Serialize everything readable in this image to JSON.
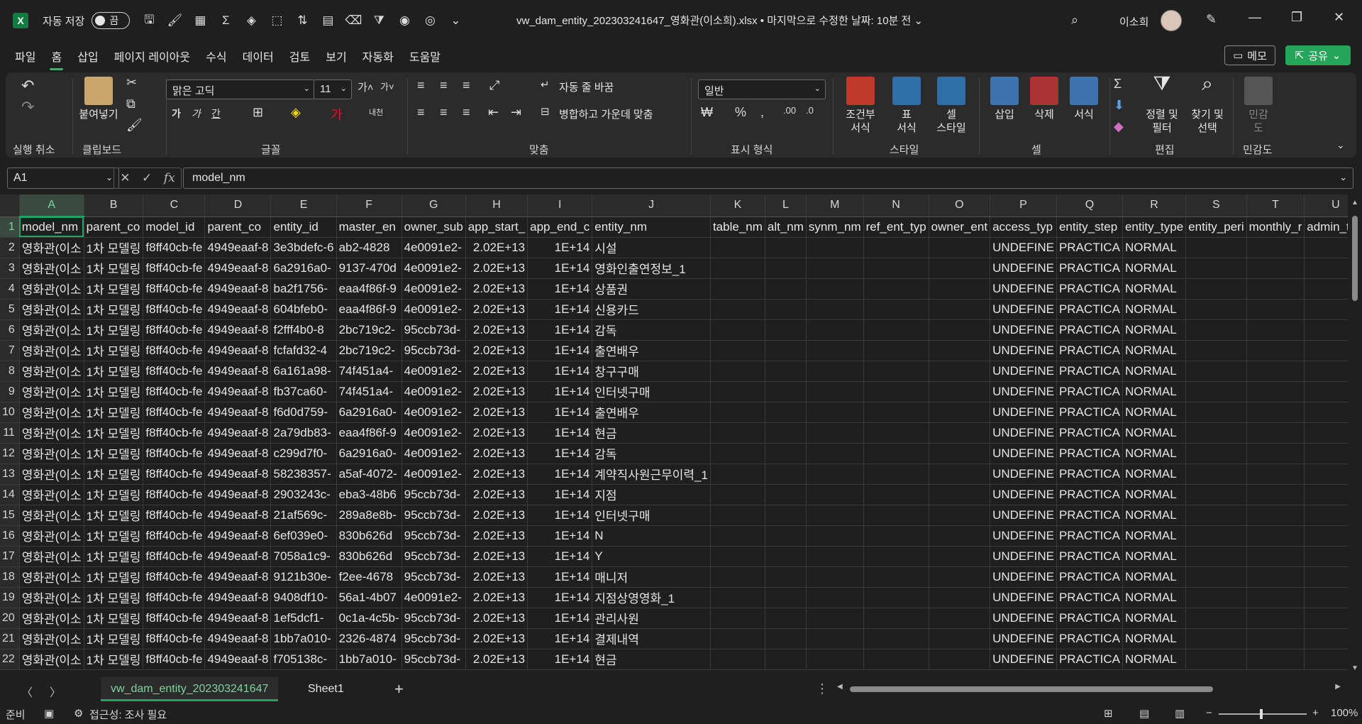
{
  "app": {
    "logo": "X",
    "autosave_label": "자동 저장",
    "autosave_state": "끔",
    "doc_title": "vw_dam_entity_202303241647_영화관(이소희).xlsx • 마지막으로 수정한 날짜: 10분 전 ⌄",
    "user_name": "이소희"
  },
  "tabs": [
    "파일",
    "홈",
    "삽입",
    "페이지 레이아웃",
    "수식",
    "데이터",
    "검토",
    "보기",
    "자동화",
    "도움말"
  ],
  "active_tab": "홈",
  "memo_label": "메모",
  "share_label": "공유",
  "ribbon": {
    "groups": {
      "undo": "실행 취소",
      "clipboard": "클립보드",
      "font": "글꼴",
      "align": "맞춤",
      "number": "표시 형식",
      "style": "스타일",
      "cells": "셀",
      "edit": "편집",
      "sensitivity": "민감도"
    },
    "paste_label": "붙여넣기",
    "font_name": "맑은 고딕",
    "font_size": "11",
    "wrap_text": "자동 줄 바꿈",
    "merge_center": "병합하고 가운데 맞춤",
    "number_format": "일반",
    "conditional": "조건부\n서식",
    "table_format": "표\n서식",
    "cell_style": "셀\n스타일",
    "insert": "삽입",
    "delete": "삭제",
    "format": "서식",
    "sort_filter": "정렬 및\n필터",
    "find_select": "찾기 및\n선택",
    "sensitivity_btn": "민감\n도"
  },
  "formula_bar": {
    "name_box": "A1",
    "formula": "model_nm"
  },
  "sheet": {
    "columns": [
      "A",
      "B",
      "C",
      "D",
      "E",
      "F",
      "G",
      "H",
      "I",
      "J",
      "K",
      "L",
      "M",
      "N",
      "O",
      "P",
      "Q",
      "R",
      "S",
      "T",
      "U"
    ],
    "header_row": [
      "model_nm",
      "parent_co",
      "model_id",
      "parent_co",
      "entity_id",
      "master_en",
      "owner_sub",
      "app_start_",
      "app_end_c",
      "entity_nm",
      "table_nm",
      "alt_nm",
      "synm_nm",
      "ref_ent_typ",
      "owner_ent",
      "access_typ",
      "entity_step",
      "entity_type",
      "entity_peri",
      "monthly_r",
      "admin_terr"
    ],
    "rows": [
      [
        "영화관(이소",
        "1차 모델링",
        "f8ff40cb-fe",
        "4949eaaf-8",
        "3e3bdefc-6",
        "ab2-4828",
        "4e0091e2-",
        "2.02E+13",
        "1E+14",
        "시설",
        "",
        "",
        "",
        "",
        "",
        "UNDEFINE",
        "PRACTICA",
        "NORMAL",
        "",
        "",
        ""
      ],
      [
        "영화관(이소",
        "1차 모델링",
        "f8ff40cb-fe",
        "4949eaaf-8",
        "6a2916a0-",
        "9137-470d",
        "4e0091e2-",
        "2.02E+13",
        "1E+14",
        "영화인출연정보_1",
        "",
        "",
        "",
        "",
        "",
        "UNDEFINE",
        "PRACTICA",
        "NORMAL",
        "",
        "",
        ""
      ],
      [
        "영화관(이소",
        "1차 모델링",
        "f8ff40cb-fe",
        "4949eaaf-8",
        "ba2f1756-",
        "eaa4f86f-9",
        "4e0091e2-",
        "2.02E+13",
        "1E+14",
        "상품권",
        "",
        "",
        "",
        "",
        "",
        "UNDEFINE",
        "PRACTICA",
        "NORMAL",
        "",
        "",
        ""
      ],
      [
        "영화관(이소",
        "1차 모델링",
        "f8ff40cb-fe",
        "4949eaaf-8",
        "604bfeb0-",
        "eaa4f86f-9",
        "4e0091e2-",
        "2.02E+13",
        "1E+14",
        "신용카드",
        "",
        "",
        "",
        "",
        "",
        "UNDEFINE",
        "PRACTICA",
        "NORMAL",
        "",
        "",
        ""
      ],
      [
        "영화관(이소",
        "1차 모델링",
        "f8ff40cb-fe",
        "4949eaaf-8",
        "f2fff4b0-8",
        "2bc719c2-",
        "95ccb73d-",
        "2.02E+13",
        "1E+14",
        "감독",
        "",
        "",
        "",
        "",
        "",
        "UNDEFINE",
        "PRACTICA",
        "NORMAL",
        "",
        "",
        ""
      ],
      [
        "영화관(이소",
        "1차 모델링",
        "f8ff40cb-fe",
        "4949eaaf-8",
        "fcfafd32-4",
        "2bc719c2-",
        "95ccb73d-",
        "2.02E+13",
        "1E+14",
        "출연배우",
        "",
        "",
        "",
        "",
        "",
        "UNDEFINE",
        "PRACTICA",
        "NORMAL",
        "",
        "",
        ""
      ],
      [
        "영화관(이소",
        "1차 모델링",
        "f8ff40cb-fe",
        "4949eaaf-8",
        "6a161a98-",
        "74f451a4-",
        "4e0091e2-",
        "2.02E+13",
        "1E+14",
        "창구구매",
        "",
        "",
        "",
        "",
        "",
        "UNDEFINE",
        "PRACTICA",
        "NORMAL",
        "",
        "",
        ""
      ],
      [
        "영화관(이소",
        "1차 모델링",
        "f8ff40cb-fe",
        "4949eaaf-8",
        "fb37ca60-",
        "74f451a4-",
        "4e0091e2-",
        "2.02E+13",
        "1E+14",
        "인터넷구매",
        "",
        "",
        "",
        "",
        "",
        "UNDEFINE",
        "PRACTICA",
        "NORMAL",
        "",
        "",
        ""
      ],
      [
        "영화관(이소",
        "1차 모델링",
        "f8ff40cb-fe",
        "4949eaaf-8",
        "f6d0d759-",
        "6a2916a0-",
        "4e0091e2-",
        "2.02E+13",
        "1E+14",
        "출연배우",
        "",
        "",
        "",
        "",
        "",
        "UNDEFINE",
        "PRACTICA",
        "NORMAL",
        "",
        "",
        ""
      ],
      [
        "영화관(이소",
        "1차 모델링",
        "f8ff40cb-fe",
        "4949eaaf-8",
        "2a79db83-",
        "eaa4f86f-9",
        "4e0091e2-",
        "2.02E+13",
        "1E+14",
        "현금",
        "",
        "",
        "",
        "",
        "",
        "UNDEFINE",
        "PRACTICA",
        "NORMAL",
        "",
        "",
        ""
      ],
      [
        "영화관(이소",
        "1차 모델링",
        "f8ff40cb-fe",
        "4949eaaf-8",
        "c299d7f0-",
        "6a2916a0-",
        "4e0091e2-",
        "2.02E+13",
        "1E+14",
        "감독",
        "",
        "",
        "",
        "",
        "",
        "UNDEFINE",
        "PRACTICA",
        "NORMAL",
        "",
        "",
        ""
      ],
      [
        "영화관(이소",
        "1차 모델링",
        "f8ff40cb-fe",
        "4949eaaf-8",
        "58238357-",
        "a5af-4072-",
        "4e0091e2-",
        "2.02E+13",
        "1E+14",
        "계약직사원근무이력_1",
        "",
        "",
        "",
        "",
        "",
        "UNDEFINE",
        "PRACTICA",
        "NORMAL",
        "",
        "",
        ""
      ],
      [
        "영화관(이소",
        "1차 모델링",
        "f8ff40cb-fe",
        "4949eaaf-8",
        "2903243c-",
        "eba3-48b6",
        "95ccb73d-",
        "2.02E+13",
        "1E+14",
        "지점",
        "",
        "",
        "",
        "",
        "",
        "UNDEFINE",
        "PRACTICA",
        "NORMAL",
        "",
        "",
        ""
      ],
      [
        "영화관(이소",
        "1차 모델링",
        "f8ff40cb-fe",
        "4949eaaf-8",
        "21af569c-",
        "289a8e8b-",
        "95ccb73d-",
        "2.02E+13",
        "1E+14",
        "인터넷구매",
        "",
        "",
        "",
        "",
        "",
        "UNDEFINE",
        "PRACTICA",
        "NORMAL",
        "",
        "",
        ""
      ],
      [
        "영화관(이소",
        "1차 모델링",
        "f8ff40cb-fe",
        "4949eaaf-8",
        "6ef039e0-",
        "830b626d",
        "95ccb73d-",
        "2.02E+13",
        "1E+14",
        "N",
        "",
        "",
        "",
        "",
        "",
        "UNDEFINE",
        "PRACTICA",
        "NORMAL",
        "",
        "",
        ""
      ],
      [
        "영화관(이소",
        "1차 모델링",
        "f8ff40cb-fe",
        "4949eaaf-8",
        "7058a1c9-",
        "830b626d",
        "95ccb73d-",
        "2.02E+13",
        "1E+14",
        "Y",
        "",
        "",
        "",
        "",
        "",
        "UNDEFINE",
        "PRACTICA",
        "NORMAL",
        "",
        "",
        ""
      ],
      [
        "영화관(이소",
        "1차 모델링",
        "f8ff40cb-fe",
        "4949eaaf-8",
        "9121b30e-",
        "f2ee-4678",
        "95ccb73d-",
        "2.02E+13",
        "1E+14",
        "매니저",
        "",
        "",
        "",
        "",
        "",
        "UNDEFINE",
        "PRACTICA",
        "NORMAL",
        "",
        "",
        ""
      ],
      [
        "영화관(이소",
        "1차 모델링",
        "f8ff40cb-fe",
        "4949eaaf-8",
        "9408df10-",
        "56a1-4b07",
        "4e0091e2-",
        "2.02E+13",
        "1E+14",
        "지점상영영화_1",
        "",
        "",
        "",
        "",
        "",
        "UNDEFINE",
        "PRACTICA",
        "NORMAL",
        "",
        "",
        ""
      ],
      [
        "영화관(이소",
        "1차 모델링",
        "f8ff40cb-fe",
        "4949eaaf-8",
        "1ef5dcf1-",
        "0c1a-4c5b-",
        "95ccb73d-",
        "2.02E+13",
        "1E+14",
        "관리사원",
        "",
        "",
        "",
        "",
        "",
        "UNDEFINE",
        "PRACTICA",
        "NORMAL",
        "",
        "",
        ""
      ],
      [
        "영화관(이소",
        "1차 모델링",
        "f8ff40cb-fe",
        "4949eaaf-8",
        "1bb7a010-",
        "2326-4874",
        "95ccb73d-",
        "2.02E+13",
        "1E+14",
        "결제내역",
        "",
        "",
        "",
        "",
        "",
        "UNDEFINE",
        "PRACTICA",
        "NORMAL",
        "",
        "",
        ""
      ],
      [
        "영화관(이소",
        "1차 모델링",
        "f8ff40cb-fe",
        "4949eaaf-8",
        "f705138c-",
        "1bb7a010-",
        "95ccb73d-",
        "2.02E+13",
        "1E+14",
        "현금",
        "",
        "",
        "",
        "",
        "",
        "UNDEFINE",
        "PRACTICA",
        "NORMAL",
        "",
        "",
        ""
      ]
    ]
  },
  "sheet_tabs": [
    "vw_dam_entity_202303241647",
    "Sheet1"
  ],
  "active_sheet": "vw_dam_entity_202303241647",
  "status": {
    "ready": "준비",
    "accessibility": "접근성: 조사 필요",
    "zoom": "100%"
  }
}
